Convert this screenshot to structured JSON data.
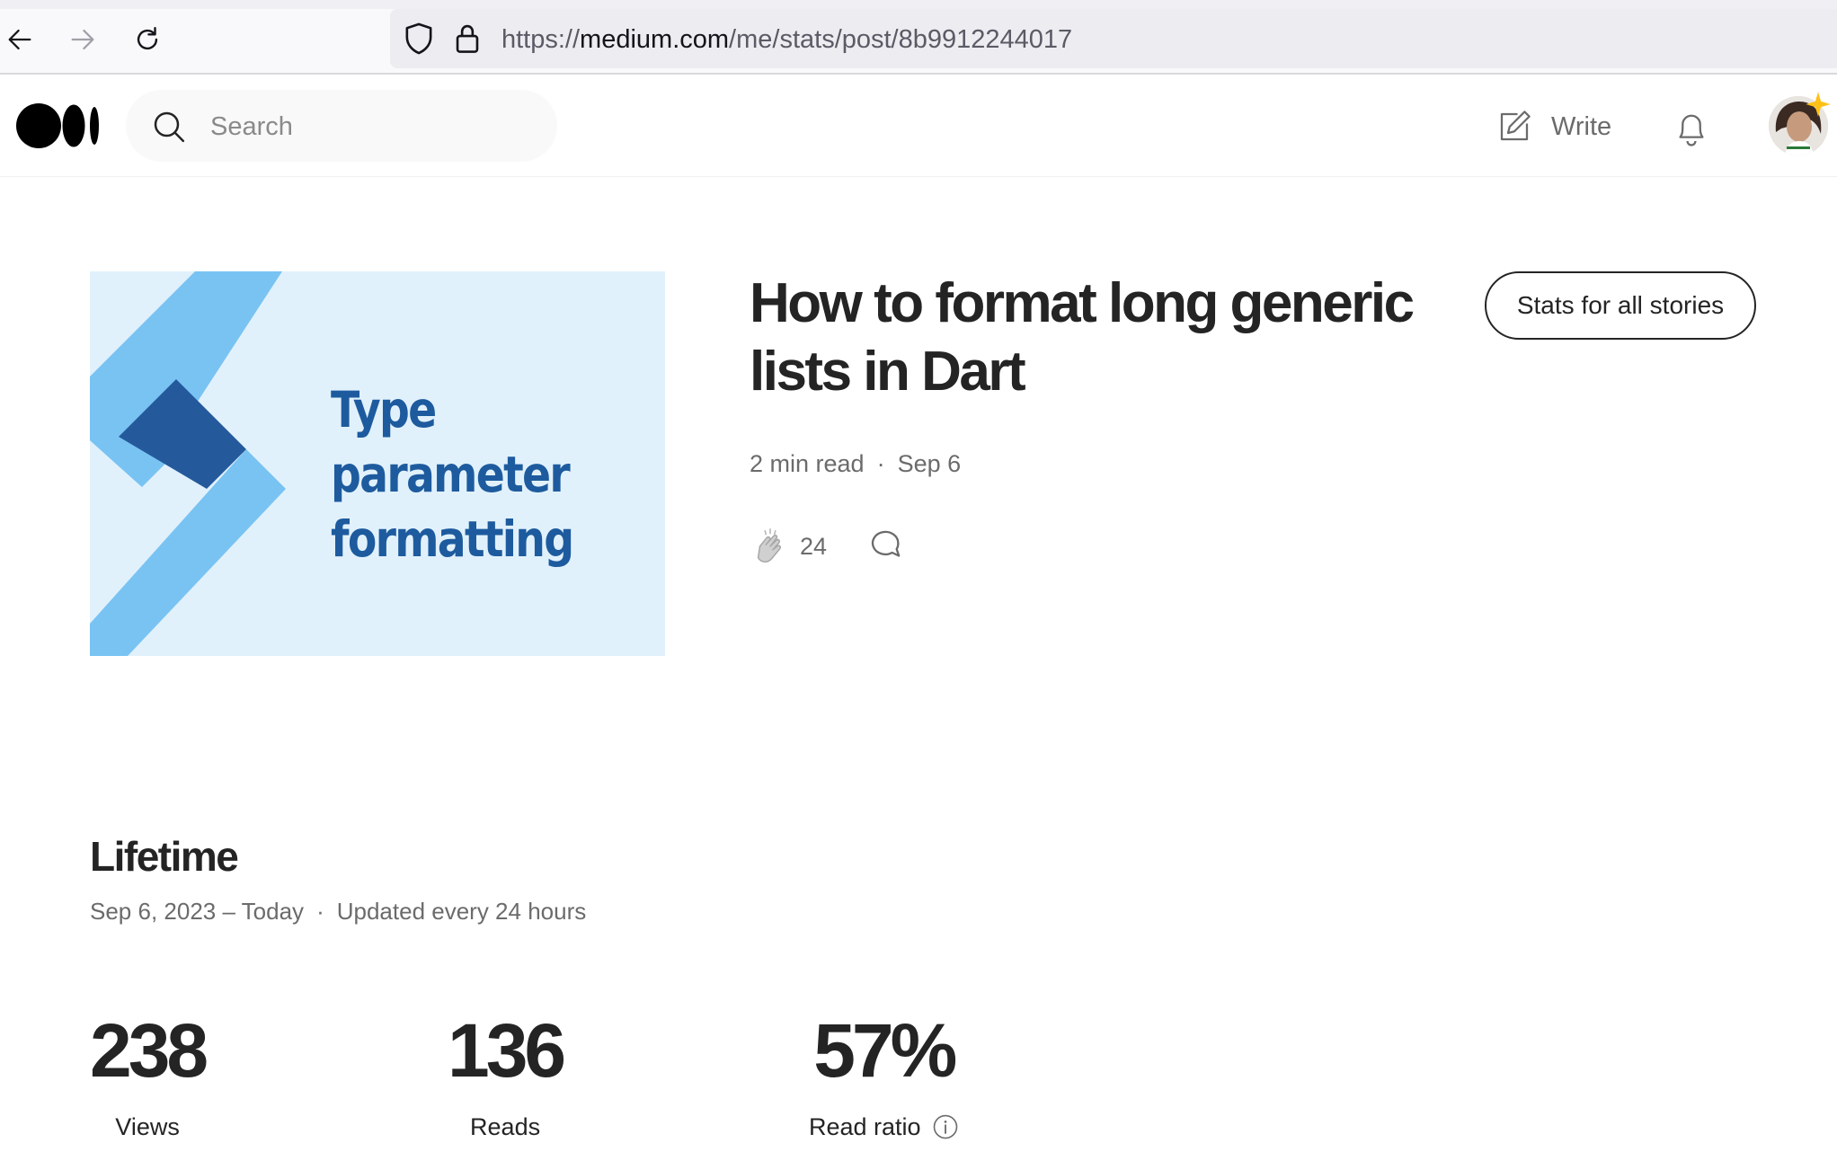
{
  "browser": {
    "url_prefix": "https://",
    "url_host": "medium.com",
    "url_path": "/me/stats/post/8b9912244017"
  },
  "header": {
    "search_placeholder": "Search",
    "write_label": "Write"
  },
  "story": {
    "hero_lines": [
      "Type",
      "parameter",
      "formatting"
    ],
    "title": "How to format long generic lists in Dart",
    "read_time": "2 min read",
    "separator": "·",
    "date": "Sep 6",
    "claps": "24",
    "stats_all_label": "Stats for all stories"
  },
  "lifetime": {
    "title": "Lifetime",
    "range": "Sep 6, 2023 – Today",
    "separator": "·",
    "update_note": "Updated every 24 hours",
    "stats": [
      {
        "value": "238",
        "label": "Views"
      },
      {
        "value": "136",
        "label": "Reads"
      },
      {
        "value": "57%",
        "label": "Read ratio"
      }
    ]
  },
  "colors": {
    "hero_background": "#e1f1fc",
    "hero_light_chevron": "#79c3f3",
    "hero_dark_chevron": "#245a9c",
    "hero_text": "#1d5b9e"
  }
}
